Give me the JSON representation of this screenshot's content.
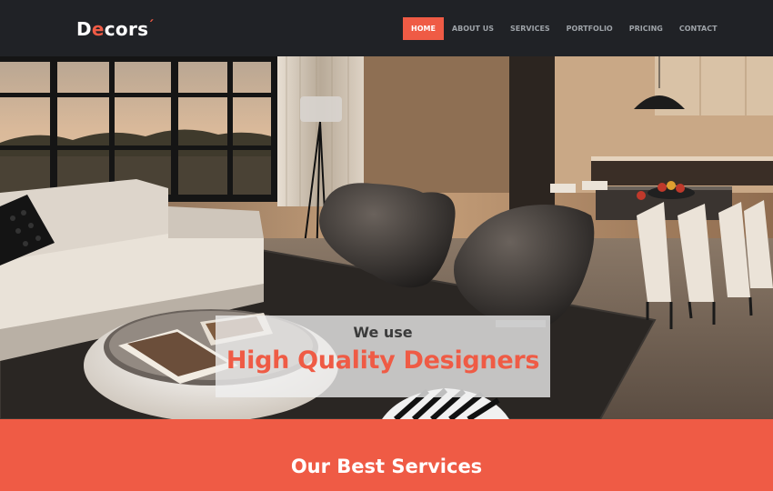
{
  "brand": {
    "logo_first": "D",
    "logo_accent": "e",
    "logo_rest": "cors",
    "logo_mark": "´"
  },
  "nav": {
    "items": [
      {
        "label": "HOME",
        "active": true
      },
      {
        "label": "ABOUT US",
        "active": false
      },
      {
        "label": "SERVICES",
        "active": false
      },
      {
        "label": "PORTFOLIO",
        "active": false
      },
      {
        "label": "PRICING",
        "active": false
      },
      {
        "label": "CONTACT",
        "active": false
      }
    ]
  },
  "hero": {
    "subtitle": "We use",
    "title": "High Quality Designers"
  },
  "services": {
    "title": "Our Best Services"
  },
  "colors": {
    "accent": "#ef5b45",
    "navbar": "#202226",
    "nav_text": "#9ea3a8"
  }
}
